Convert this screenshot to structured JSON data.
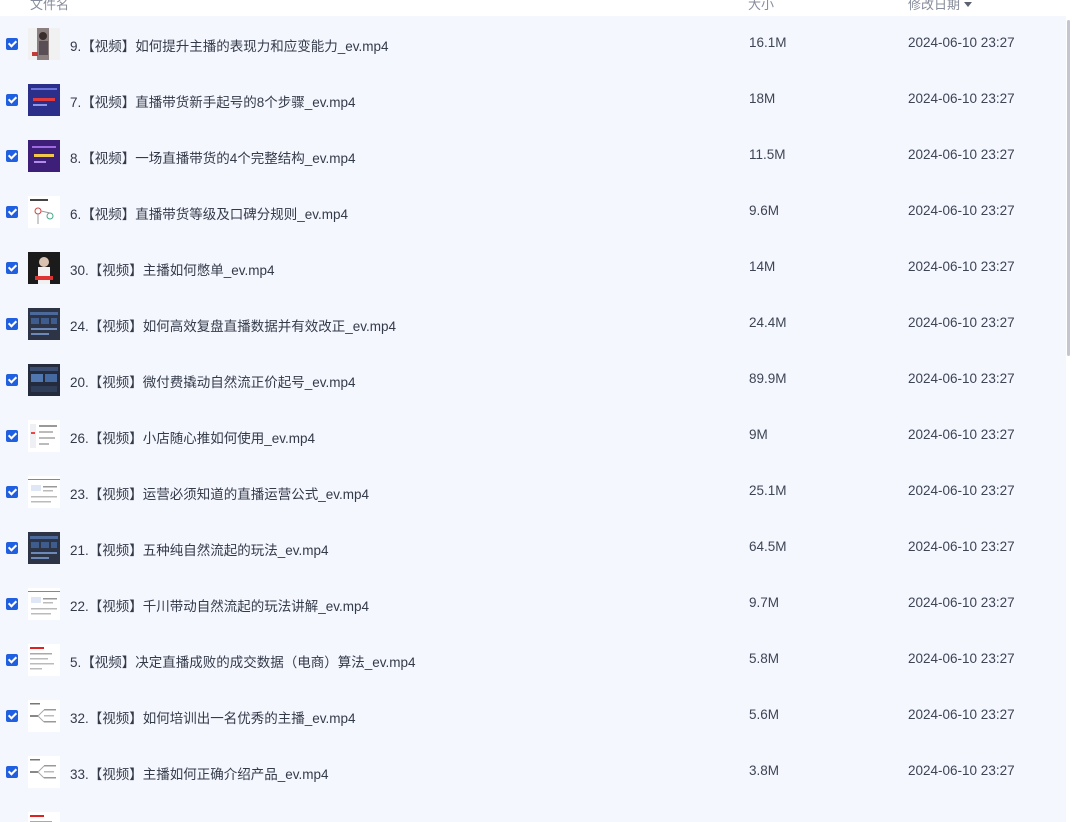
{
  "header": {
    "name_label": "文件名",
    "size_label": "大小",
    "date_label": "修改日期",
    "sort_icon": "caret-down-icon"
  },
  "accent_color": "#1f5fe0",
  "files": [
    {
      "name": "9.【视频】如何提升主播的表现力和应变能力_ev.mp4",
      "size": "16.1M",
      "date": "2024-06-10 23:27",
      "checked": true,
      "thumb": "photo-person"
    },
    {
      "name": "7.【视频】直播带货新手起号的8个步骤_ev.mp4",
      "size": "18M",
      "date": "2024-06-10 23:27",
      "checked": true,
      "thumb": "slide-navy"
    },
    {
      "name": "8.【视频】一场直播带货的4个完整结构_ev.mp4",
      "size": "11.5M",
      "date": "2024-06-10 23:27",
      "checked": true,
      "thumb": "slide-purple"
    },
    {
      "name": "6.【视频】直播带货等级及口碑分规则_ev.mp4",
      "size": "9.6M",
      "date": "2024-06-10 23:27",
      "checked": true,
      "thumb": "mindmap"
    },
    {
      "name": "30.【视频】主播如何憋单_ev.mp4",
      "size": "14M",
      "date": "2024-06-10 23:27",
      "checked": true,
      "thumb": "photo-dark"
    },
    {
      "name": "24.【视频】如何高效复盘直播数据并有效改正_ev.mp4",
      "size": "24.4M",
      "date": "2024-06-10 23:27",
      "checked": true,
      "thumb": "dashboard"
    },
    {
      "name": "20.【视频】微付费撬动自然流正价起号_ev.mp4",
      "size": "89.9M",
      "date": "2024-06-10 23:27",
      "checked": true,
      "thumb": "dashboard-alt"
    },
    {
      "name": "26.【视频】小店随心推如何使用_ev.mp4",
      "size": "9M",
      "date": "2024-06-10 23:27",
      "checked": true,
      "thumb": "doc-grid"
    },
    {
      "name": "23.【视频】运营必须知道的直播运营公式_ev.mp4",
      "size": "25.1M",
      "date": "2024-06-10 23:27",
      "checked": true,
      "thumb": "doc-lines"
    },
    {
      "name": "21.【视频】五种纯自然流起的玩法_ev.mp4",
      "size": "64.5M",
      "date": "2024-06-10 23:27",
      "checked": true,
      "thumb": "dashboard"
    },
    {
      "name": "22.【视频】千川带动自然流起的玩法讲解_ev.mp4",
      "size": "9.7M",
      "date": "2024-06-10 23:27",
      "checked": true,
      "thumb": "doc-lines"
    },
    {
      "name": "5.【视频】决定直播成败的成交数据（电商）算法_ev.mp4",
      "size": "5.8M",
      "date": "2024-06-10 23:27",
      "checked": true,
      "thumb": "doc-red"
    },
    {
      "name": "32.【视频】如何培训出一名优秀的主播_ev.mp4",
      "size": "5.6M",
      "date": "2024-06-10 23:27",
      "checked": true,
      "thumb": "doc-tree"
    },
    {
      "name": "33.【视频】主播如何正确介绍产品_ev.mp4",
      "size": "3.8M",
      "date": "2024-06-10 23:27",
      "checked": true,
      "thumb": "doc-tree"
    },
    {
      "name": "",
      "size": "",
      "date": "",
      "checked": false,
      "thumb": "doc-red"
    }
  ]
}
